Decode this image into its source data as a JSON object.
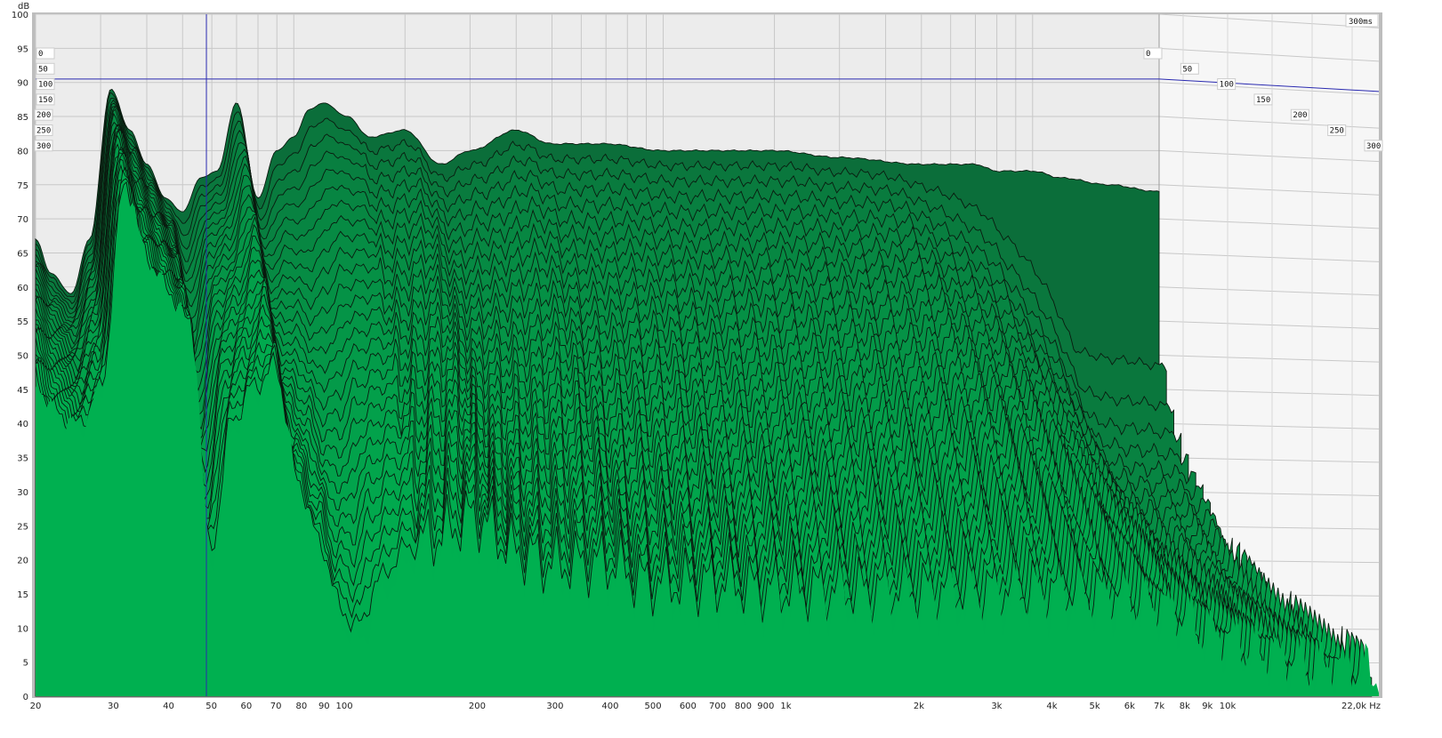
{
  "chart_data": {
    "type": "area",
    "subtype": "waterfall",
    "title": "",
    "ylabel": "dB",
    "xlabel": "Hz",
    "ylim": [
      0,
      100
    ],
    "xlim": [
      20,
      22000
    ],
    "xscale": "log",
    "grid": true,
    "y_ticks": [
      0,
      5,
      10,
      15,
      20,
      25,
      30,
      35,
      40,
      45,
      50,
      55,
      60,
      65,
      70,
      75,
      80,
      85,
      90,
      95,
      100
    ],
    "x_ticks": [
      {
        "f": 20,
        "label": "20"
      },
      {
        "f": 30,
        "label": "30"
      },
      {
        "f": 40,
        "label": "40"
      },
      {
        "f": 50,
        "label": "50"
      },
      {
        "f": 60,
        "label": "60"
      },
      {
        "f": 70,
        "label": "70"
      },
      {
        "f": 80,
        "label": "80"
      },
      {
        "f": 90,
        "label": "90"
      },
      {
        "f": 100,
        "label": "100"
      },
      {
        "f": 200,
        "label": "200"
      },
      {
        "f": 300,
        "label": "300"
      },
      {
        "f": 400,
        "label": "400"
      },
      {
        "f": 500,
        "label": "500"
      },
      {
        "f": 600,
        "label": "600"
      },
      {
        "f": 700,
        "label": "700"
      },
      {
        "f": 800,
        "label": "800"
      },
      {
        "f": 900,
        "label": "900"
      },
      {
        "f": 1000,
        "label": "1k"
      },
      {
        "f": 2000,
        "label": "2k"
      },
      {
        "f": 3000,
        "label": "3k"
      },
      {
        "f": 4000,
        "label": "4k"
      },
      {
        "f": 5000,
        "label": "5k"
      },
      {
        "f": 6000,
        "label": "6k"
      },
      {
        "f": 7000,
        "label": "7k"
      },
      {
        "f": 8000,
        "label": "8k"
      },
      {
        "f": 9000,
        "label": "9k"
      },
      {
        "f": 10000,
        "label": "10k"
      },
      {
        "f": 22000,
        "label": "22,0k Hz"
      }
    ],
    "time_labels_ms": [
      "0",
      "50",
      "100",
      "150",
      "200",
      "250",
      "300"
    ],
    "time_range_label": "300ms",
    "slices": 30,
    "cursor": {
      "freq_hz": 58,
      "db": 90.5
    },
    "frequencies": [
      20,
      22,
      25,
      28,
      32,
      36,
      40,
      45,
      50,
      56,
      62,
      70,
      80,
      90,
      100,
      110,
      120,
      140,
      160,
      200,
      250,
      300,
      400,
      500,
      700,
      1000,
      2000,
      3000,
      5000,
      7000,
      8000,
      9000,
      10000,
      12000,
      16000,
      22000
    ],
    "series": [
      {
        "name": "0 ms",
        "values": [
          67,
          62,
          59,
          67,
          89,
          83,
          78,
          73,
          71,
          76,
          77,
          87,
          73,
          80,
          82,
          86,
          87,
          85,
          82,
          83,
          78,
          80,
          83,
          81,
          81,
          80,
          80,
          79,
          78,
          78,
          77,
          77,
          77,
          76,
          75,
          74
        ]
      },
      {
        "name": "300 ms",
        "values": [
          47,
          42,
          40,
          45,
          76,
          65,
          60,
          55,
          20,
          40,
          45,
          48,
          30,
          20,
          10,
          8,
          15,
          20,
          22,
          25,
          20,
          18,
          18,
          15,
          15,
          14,
          14,
          14,
          14,
          13,
          11,
          9,
          8,
          6,
          4,
          3
        ]
      }
    ],
    "colors": {
      "fill_front": "#00b050",
      "fill_back": "#0b6e3a",
      "stroke": "#0a1a0f",
      "grid": "#c8c8c8",
      "background": "#ececec",
      "cursor": "#2a2ab0"
    }
  }
}
